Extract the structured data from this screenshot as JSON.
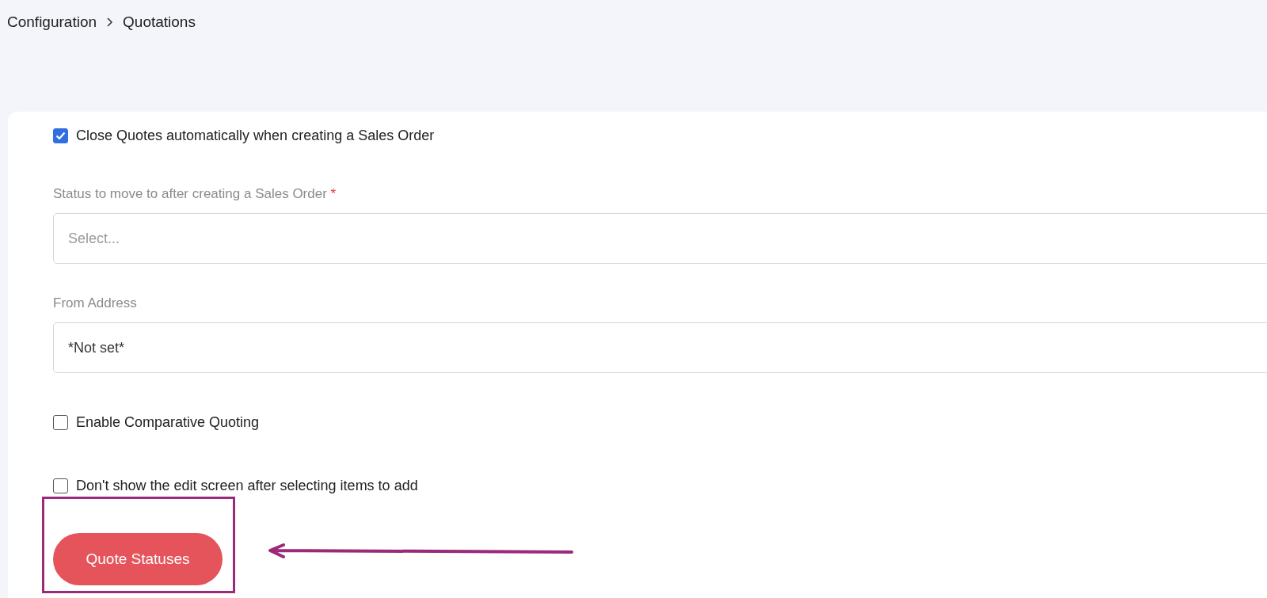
{
  "breadcrumb": [
    {
      "label": "Configuration"
    },
    {
      "label": "Quotations"
    }
  ],
  "settings": [
    {
      "kind": "checkbox",
      "label": "Close Quotes automatically when creating a Sales Order",
      "checked": true
    },
    {
      "kind": "select",
      "label": "Status to move to after creating a Sales Order",
      "required_mark": "*",
      "placeholder": "Select..."
    },
    {
      "kind": "select",
      "label": "From Address",
      "value": "*Not set*"
    },
    {
      "kind": "checkbox",
      "label": "Enable Comparative Quoting",
      "checked": false
    },
    {
      "kind": "checkbox",
      "label": "Don't show the edit screen after selecting items to add",
      "checked": false
    }
  ],
  "button": {
    "label": "Quote Statuses"
  }
}
